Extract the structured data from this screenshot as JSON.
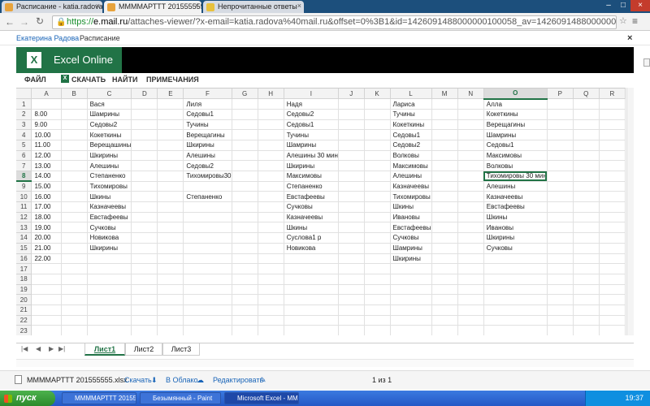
{
  "browser": {
    "tabs": [
      {
        "title": "Расписание - katia.radova@",
        "favicon_color": "#e8a33c"
      },
      {
        "title": "МММMАРТТТ 201555555.xls",
        "favicon_color": "#e8a33c"
      },
      {
        "title": "Непрочитанные ответы",
        "favicon_color": "#e8c13c"
      }
    ],
    "url_scheme": "https://",
    "url_host": "e.mail.ru",
    "url_path": "/attaches-viewer/?x-email=katia.radova%40mail.ru&offset=0%3B1&id=1426091488000000100058_av=1426091488000000100059"
  },
  "breadcrumb": {
    "user": "Екатерина Радова",
    "folder": "Расписание"
  },
  "app": {
    "name": "Excel Online",
    "menu": [
      "ФАЙЛ",
      "СКАЧАТЬ",
      "НАЙТИ",
      "ПРИМЕЧАНИЯ"
    ]
  },
  "sheet": {
    "columns": [
      "A",
      "B",
      "C",
      "D",
      "E",
      "F",
      "G",
      "H",
      "I",
      "J",
      "K",
      "L",
      "M",
      "N",
      "O",
      "P",
      "Q",
      "R"
    ],
    "selected_column": "O",
    "selected_row": "8",
    "rows": [
      {
        "n": "1",
        "cells": {
          "C": "Вася",
          "F": "Лиля",
          "I": "Надя",
          "L": "Лариса",
          "O": "Алла"
        }
      },
      {
        "n": "2",
        "cells": {
          "A": "8.00",
          "C": "Шамрины",
          "F": "Седовы1",
          "I": "Седовы2",
          "L": "Тучины",
          "O": "Кокеткины"
        }
      },
      {
        "n": "3",
        "cells": {
          "A": "9.00",
          "C": "Седовы2",
          "F": "Тучины",
          "I": "Седовы1",
          "L": "Кокеткины",
          "O": "Верещагины"
        }
      },
      {
        "n": "4",
        "cells": {
          "A": "10.00",
          "C": "Кокеткины",
          "F": "Верещагины",
          "I": "Тучины",
          "L": "Седовы1",
          "O": "Шамрины"
        }
      },
      {
        "n": "5",
        "cells": {
          "A": "11.00",
          "C": "Верещашины",
          "F": "Шкирины",
          "I": "Шамрины",
          "L": "Седовы2",
          "O": "Седовы1"
        }
      },
      {
        "n": "6",
        "cells": {
          "A": "12.00",
          "C": "Шкирины",
          "F": "Алешины",
          "I": "Алешины 30 мин",
          "L": "Волковы",
          "O": "Максимовы"
        }
      },
      {
        "n": "7",
        "cells": {
          "A": "13.00",
          "C": "Алешины",
          "F": "Седовы2",
          "I": "Шкирины",
          "L": "Максимовы",
          "O": "Волковы"
        }
      },
      {
        "n": "8",
        "cells": {
          "A": "14.00",
          "C": "Степаненко",
          "F": "Тихомировы30",
          "I": "Максимовы",
          "L": "Алешины",
          "O": "Тихомировы 30 мин"
        }
      },
      {
        "n": "9",
        "cells": {
          "A": "15.00",
          "C": "Тихомировы",
          "I": "Степаненко",
          "L": "Казначеевы",
          "O": "Алешины"
        }
      },
      {
        "n": "10",
        "cells": {
          "A": "16.00",
          "C": "Шкины",
          "F": "Степаненко",
          "I": "Евстафеевы",
          "L": "Тихомировы",
          "O": "Казначеевы"
        }
      },
      {
        "n": "11",
        "cells": {
          "A": "17.00",
          "C": "Казначеевы",
          "I": "Сучковы",
          "L": "Шкины",
          "O": "Евстафеевы"
        }
      },
      {
        "n": "12",
        "cells": {
          "A": "18.00",
          "C": "Евстафеевы",
          "I": "Казначеевы",
          "L": "Ивановы",
          "O": "Шкины"
        }
      },
      {
        "n": "13",
        "cells": {
          "A": "19.00",
          "C": "Сучковы",
          "I": "Шкины",
          "L": "Евстафеевы",
          "O": "Ивановы"
        }
      },
      {
        "n": "14",
        "cells": {
          "A": "20.00",
          "C": "Новикова",
          "I": "Суслова1 р",
          "L": "Сучковы",
          "O": "Шкирины"
        }
      },
      {
        "n": "15",
        "cells": {
          "A": "21.00",
          "C": "Шкирины",
          "I": "Новикова",
          "L": "Шамрины",
          "O": "Сучковы"
        }
      },
      {
        "n": "16",
        "cells": {
          "A": "22.00",
          "L": "Шкирины"
        }
      },
      {
        "n": "17",
        "cells": {}
      },
      {
        "n": "18",
        "cells": {}
      },
      {
        "n": "19",
        "cells": {}
      },
      {
        "n": "20",
        "cells": {}
      },
      {
        "n": "21",
        "cells": {}
      },
      {
        "n": "22",
        "cells": {}
      },
      {
        "n": "23",
        "cells": {}
      },
      {
        "n": "24",
        "cells": {}
      }
    ],
    "tabs": [
      "Лист1",
      "Лист2",
      "Лист3"
    ],
    "active_tab": "Лист1"
  },
  "attachments": {
    "filename": "МММMАРТТТ 201555555.xlsx",
    "download": "Скачать",
    "cloud": "В Облако",
    "edit": "Редактировать",
    "counter": "1 из 1"
  },
  "taskbar": {
    "start": "пуск",
    "items": [
      "МММMАРТТТ 201555...",
      "Безымянный - Paint",
      "Microsoft Excel - МM..."
    ],
    "clock": "19:37"
  },
  "colors": {
    "excel_green": "#217346",
    "taskbar_blue": "#2458c6"
  }
}
